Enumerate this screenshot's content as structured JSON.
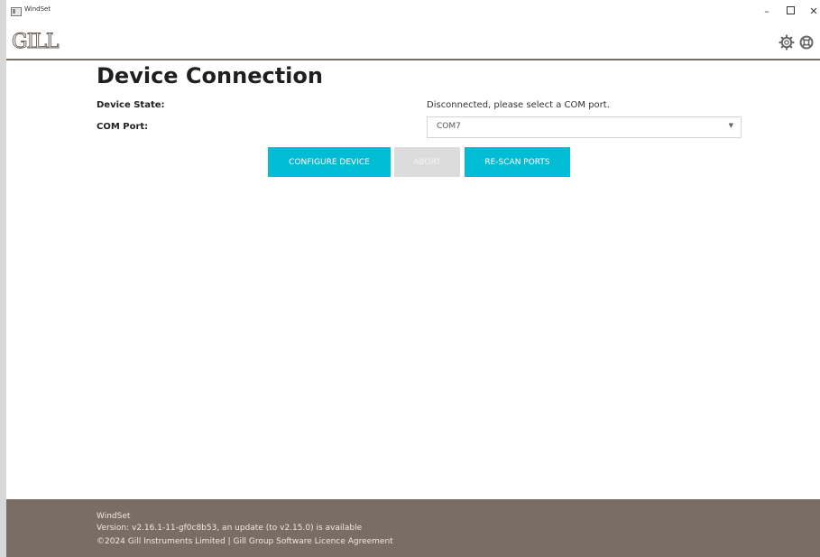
{
  "window": {
    "title": "WindSet",
    "controls": {
      "minimize": "–",
      "maximize": "□",
      "close": "✕"
    }
  },
  "header": {
    "logo": "GILL",
    "icons": [
      "gear-icon",
      "lifebuoy-icon"
    ]
  },
  "main": {
    "title": "Device Connection",
    "device_state_label": "Device State:",
    "device_state_value": "Disconnected, please select a COM port.",
    "com_port_label": "COM Port:",
    "com_port_value": "COM7",
    "buttons": {
      "configure": "CONFIGURE DEVICE",
      "abort": "ABORT",
      "rescan": "RE-SCAN PORTS"
    }
  },
  "footer": {
    "app_name": "WindSet",
    "version": "Version: v2.16.1-11-gf0c8b53, an update (to v2.15.0) is available",
    "copyright": "©2024 Gill Instruments Limited",
    "separator": "|",
    "licence_link": "Gill Group Software Licence Agreement"
  },
  "colors": {
    "accent": "#00bcd4",
    "disabled": "#dcdcdc",
    "footer": "#7a6d63"
  }
}
